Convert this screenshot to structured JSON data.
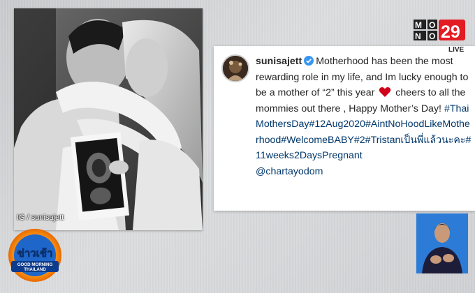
{
  "photo": {
    "caption": "IG / sunisajett"
  },
  "post": {
    "username": "sunisajett",
    "text_before_heart": "Motherhood has been the most rewarding role in my life, and Im lucky enough to be a mother of “2” this year",
    "text_after_heart": "cheers to all the mommies out there , Happy Mother’s Day!",
    "hashtags": "#ThaiMothersDay#12Aug2020#AintNoHoodLikeMotherhood#WelcomeBABY#2#Tristanเป็นพี่แล้วนะคะ#11weeks2DaysPregnant",
    "mention": "@chartayodom",
    "icons": {
      "verified": "verified-badge-icon",
      "heart": "heart-emoji-icon"
    },
    "colors": {
      "hashtag": "#00376b",
      "verified": "#3897f0",
      "heart": "#d0021b"
    }
  },
  "channel_logo": {
    "text_mono": "MONO",
    "text_num": "29",
    "live": "LIVE"
  },
  "show_logo": {
    "title": "ข่าวเช้า",
    "subtitle": "GOOD MORNING THAILAND"
  }
}
